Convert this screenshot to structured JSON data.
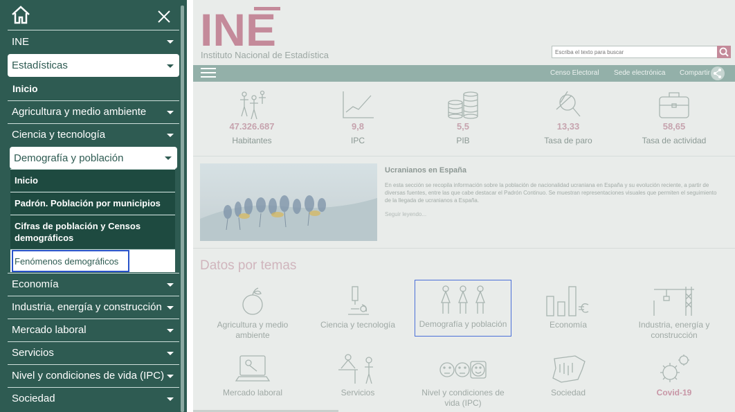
{
  "sidebar": {
    "home_icon": "home-icon",
    "close_icon": "close-icon",
    "items": [
      {
        "label": "INE"
      },
      {
        "label": "Estadísticas"
      },
      {
        "label": "Inicio"
      },
      {
        "label": "Agricultura y medio ambiente"
      },
      {
        "label": "Ciencia y tecnología"
      },
      {
        "label": "Demografía y población"
      },
      {
        "label": "Economía"
      },
      {
        "label": "Industria, energía y construcción"
      },
      {
        "label": "Mercado laboral"
      },
      {
        "label": "Servicios"
      },
      {
        "label": "Nivel y condiciones de vida (IPC)"
      },
      {
        "label": "Sociedad"
      }
    ],
    "demografia_sub": [
      {
        "label": "Inicio"
      },
      {
        "label": "Padrón. Población por municipios"
      },
      {
        "label": "Cifras de población y Censos demográficos"
      },
      {
        "label": "Fenómenos demográficos"
      }
    ]
  },
  "header": {
    "logo_text": "INE",
    "logo_sub": "Instituto Nacional de Estadística",
    "search_placeholder": "Escriba el texto para buscar"
  },
  "navbar": {
    "links": [
      "Censo Electoral",
      "Sede electrónica",
      "Compartir"
    ]
  },
  "stats": [
    {
      "value": "47.326.687",
      "label": "Habitantes"
    },
    {
      "value": "9,8",
      "label": "IPC"
    },
    {
      "value": "5,5",
      "label": "PIB"
    },
    {
      "value": "13,33",
      "label": "Tasa de paro"
    },
    {
      "value": "58,65",
      "label": "Tasa de actividad"
    }
  ],
  "news": {
    "title": "Ucranianos en España",
    "text": "En esta sección se recopila información sobre la población de nacionalidad ucraniana en España y su evolución reciente, a partir de diversas fuentes, entre las que cabe destacar el Padrón Continuo. Se muestran representaciones visuales que permiten el seguimiento de la llegada de ucranianos a España.",
    "more": "Seguir leyendo..."
  },
  "themes": {
    "title": "Datos por temas",
    "items": [
      {
        "label": "Agricultura y medio ambiente"
      },
      {
        "label": "Ciencia y tecnología"
      },
      {
        "label": "Demografía y población"
      },
      {
        "label": "Economía"
      },
      {
        "label": "Industria, energía y construcción"
      },
      {
        "label": "Mercado laboral"
      },
      {
        "label": "Servicios"
      },
      {
        "label": "Nivel y condiciones de vida (IPC)"
      },
      {
        "label": "Sociedad"
      },
      {
        "label": "Covid-19"
      }
    ]
  },
  "colors": {
    "sidebar": "#2e5b52",
    "accent": "#c48a9a",
    "navbar": "#93b0a9",
    "focus": "#2852c9"
  }
}
